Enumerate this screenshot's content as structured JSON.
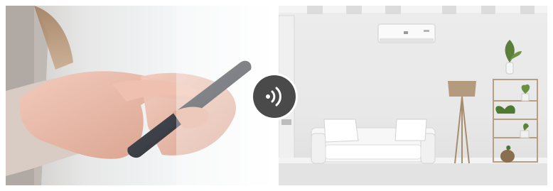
{
  "scene": {
    "left_panel": "phone-in-hands-photo",
    "right_panel": "living-room-with-air-conditioner-photo",
    "connector_icon": "wireless-signal-icon"
  },
  "colors": {
    "badge": "#4a4a4a",
    "badge_icon": "#ffffff",
    "wall": "#ececec",
    "floor": "#e4e4e4",
    "phone": "#2a2d33",
    "skin": "#e8b8a8"
  }
}
